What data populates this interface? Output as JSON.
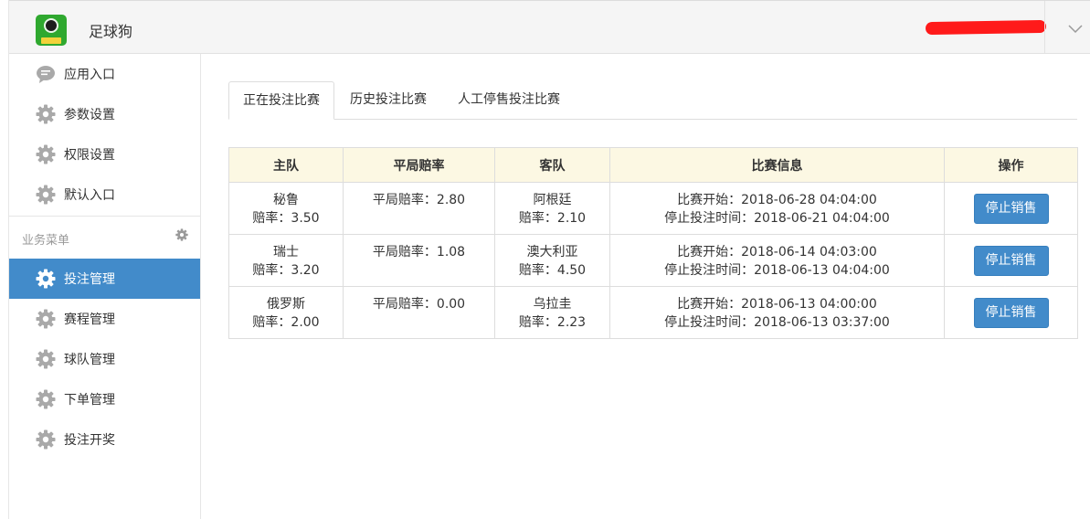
{
  "app": {
    "title": "足球狗"
  },
  "colors": {
    "accent": "#428bca",
    "table_header_bg": "#fcf8e3",
    "user_redaction": "#ff1a1a"
  },
  "sidebar": {
    "items_top": [
      {
        "label": "应用入口",
        "icon": "chat-bubble-icon"
      },
      {
        "label": "参数设置",
        "icon": "gear-icon"
      },
      {
        "label": "权限设置",
        "icon": "gear-icon"
      },
      {
        "label": "默认入口",
        "icon": "gear-icon"
      }
    ],
    "section_title": "业务菜单",
    "items_business": [
      {
        "label": "投注管理",
        "icon": "gear-icon",
        "active": true
      },
      {
        "label": "赛程管理",
        "icon": "gear-icon"
      },
      {
        "label": "球队管理",
        "icon": "gear-icon"
      },
      {
        "label": "下单管理",
        "icon": "gear-icon"
      },
      {
        "label": "投注开奖",
        "icon": "gear-icon"
      }
    ]
  },
  "tabs": [
    {
      "label": "正在投注比赛",
      "active": true
    },
    {
      "label": "历史投注比赛",
      "active": false
    },
    {
      "label": "人工停售投注比赛",
      "active": false
    }
  ],
  "table": {
    "headers": [
      "主队",
      "平局赔率",
      "客队",
      "比赛信息",
      "操作"
    ],
    "rows": [
      {
        "home": "秘鲁",
        "home_odds": "赔率：3.50",
        "draw": "平局赔率：2.80",
        "away": "阿根廷",
        "away_odds": "赔率：2.10",
        "start": "比赛开始：2018-06-28 04:04:00",
        "stop": "停止投注时间：2018-06-21 04:04:00",
        "action": "停止销售"
      },
      {
        "home": "瑞士",
        "home_odds": "赔率：3.20",
        "draw": "平局赔率：1.08",
        "away": "澳大利亚",
        "away_odds": "赔率：4.50",
        "start": "比赛开始：2018-06-14 04:03:00",
        "stop": "停止投注时间：2018-06-13 04:04:00",
        "action": "停止销售"
      },
      {
        "home": "俄罗斯",
        "home_odds": "赔率：2.00",
        "draw": "平局赔率：0.00",
        "away": "乌拉圭",
        "away_odds": "赔率：2.23",
        "start": "比赛开始：2018-06-13 04:00:00",
        "stop": "停止投注时间：2018-06-13 03:37:00",
        "action": "停止销售"
      }
    ]
  }
}
